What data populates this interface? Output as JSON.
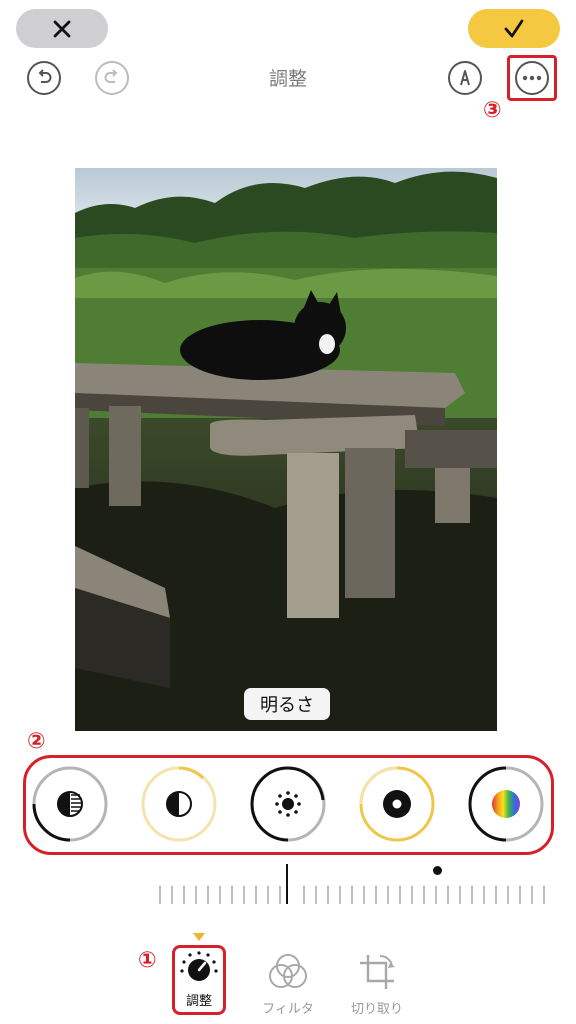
{
  "toolbar": {
    "cancel_icon": "close-icon",
    "done_icon": "checkmark-icon",
    "undo_icon": "undo-icon",
    "redo_icon": "redo-icon",
    "title": "調整",
    "markup_icon": "markup-pen-icon",
    "more_icon": "more-ellipsis-icon",
    "accent_color": "#f5c842"
  },
  "annotations": {
    "marker1": "①",
    "marker2": "②",
    "marker3": "③",
    "color": "#d6202a"
  },
  "photo": {
    "parameter_label": "明るさ"
  },
  "tools": [
    {
      "name": "exposure-icon"
    },
    {
      "name": "brilliance-icon"
    },
    {
      "name": "brightness-icon"
    },
    {
      "name": "black-point-icon"
    },
    {
      "name": "saturation-icon"
    }
  ],
  "tabs": {
    "adjust": "調整",
    "filters": "フィルタ",
    "crop": "切り取り"
  }
}
